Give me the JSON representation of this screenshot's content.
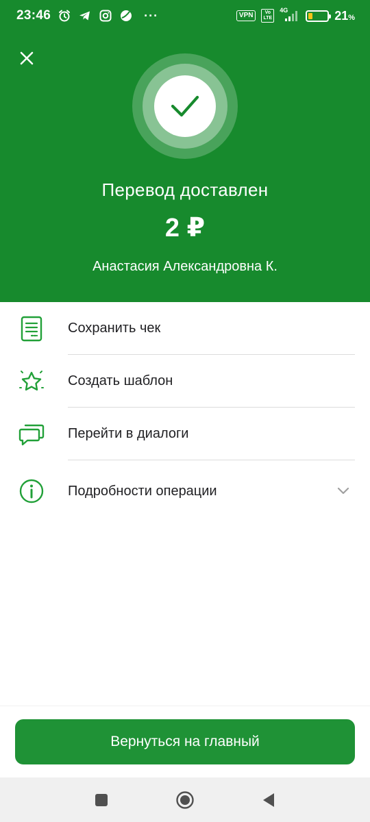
{
  "status_bar": {
    "time": "23:46",
    "dots": "···",
    "vpn": "VPN",
    "volte": "Vo\nLTE",
    "network": "4G",
    "battery_percent": "21",
    "battery_unit": "%",
    "battery_level": 0.21,
    "icons": [
      "alarm-icon",
      "telegram-icon",
      "instagram-icon",
      "globe-icon"
    ]
  },
  "header": {
    "close_icon": "close-icon",
    "success_icon": "checkmark-icon",
    "title": "Перевод доставлен",
    "amount": "2 ₽",
    "recipient": "Анастасия Александровна К."
  },
  "actions": [
    {
      "label": "Сохранить чек",
      "icon": "receipt-icon"
    },
    {
      "label": "Создать шаблон",
      "icon": "star-icon"
    },
    {
      "label": "Перейти в диалоги",
      "icon": "chat-icon"
    },
    {
      "label": "Подробности операции",
      "icon": "info-icon",
      "trailing": "chevron-down-icon"
    }
  ],
  "footer": {
    "return_label": "Вернуться на главный"
  },
  "nav": [
    "recents-icon",
    "home-icon",
    "back-icon"
  ],
  "colors": {
    "brand_green": "#178a2d",
    "button_green": "#1f9236",
    "icon_green": "#21a038"
  }
}
